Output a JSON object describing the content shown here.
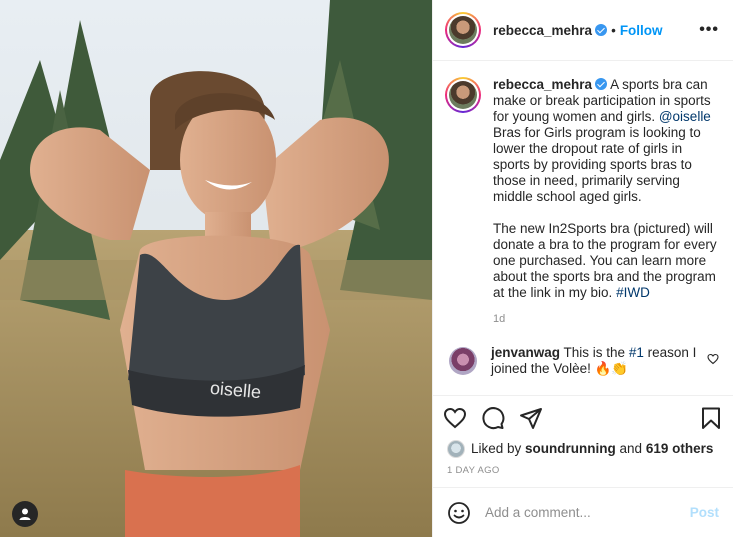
{
  "post": {
    "username": "rebecca_mehra",
    "follow_label": "Follow",
    "separator": "•",
    "more_label": "•••",
    "caption": {
      "part1": "A sports bra can make or break participation in sports for young women and girls. ",
      "mention": "@oiselle",
      "part2": " Bras for Girls program is looking to lower the dropout rate of girls in sports by providing sports bras to those in need, primarily serving middle school aged girls.",
      "paragraph2": "The new In2Sports bra (pictured) will donate a bra to the program for every one purchased. You can learn more about the sports bra and the program at the link in my bio. ",
      "hashtag": "#IWD"
    },
    "caption_time": "1d",
    "comment": {
      "username": "jenvanwag",
      "text_before": "This is the ",
      "hashtag": "#1",
      "text_after": " reason I joined the Volèe! 🔥👏"
    },
    "likes": {
      "prefix": "Liked by ",
      "user": "soundrunning",
      "middle": " and ",
      "others": "619 others"
    },
    "date": "1 DAY AGO",
    "add_comment_placeholder": "Add a comment...",
    "post_label": "Post",
    "photo_brand": "oiselle"
  },
  "icons": {
    "verified": "verified-badge-icon",
    "like": "heart-icon",
    "comment": "comment-bubble-icon",
    "share": "paper-plane-icon",
    "save": "bookmark-icon",
    "emoji": "smiley-icon",
    "tag": "user-tag-icon"
  },
  "colors": {
    "link": "#00376b",
    "follow": "#0095f6",
    "muted": "#8e8e8e",
    "post_disabled": "#b2dffc"
  }
}
